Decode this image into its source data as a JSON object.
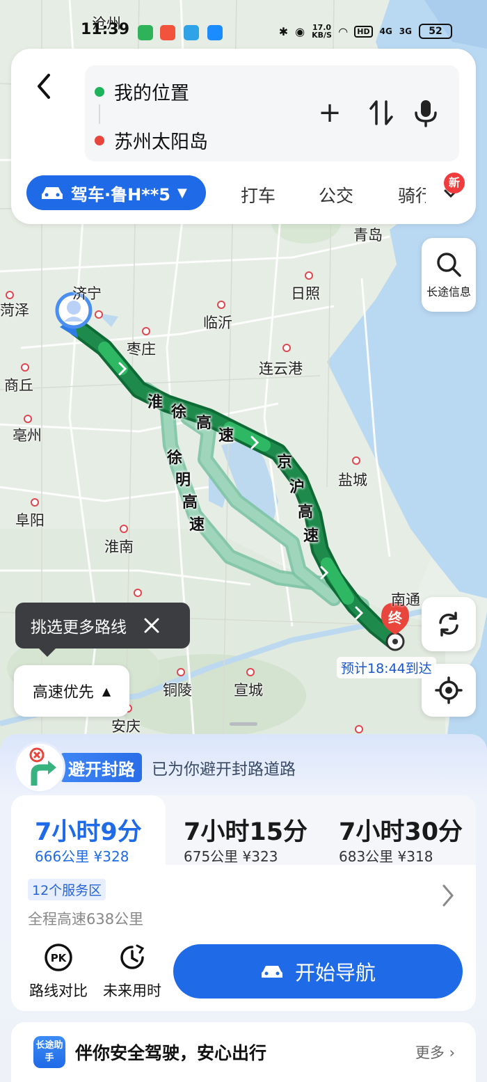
{
  "status_bar": {
    "time": "11:39",
    "net_speed": "17.0",
    "net_unit": "KB/S",
    "hd": "HD",
    "sig1": "4G",
    "sig2": "3G",
    "battery": "52"
  },
  "search": {
    "origin": "我的位置",
    "destination": "苏州太阳岛"
  },
  "modes": {
    "active": "驾车·鲁H**5",
    "tabs": [
      "打车",
      "公交",
      "骑行"
    ],
    "new_badge": "新"
  },
  "map": {
    "cities": [
      "沧州",
      "济宁",
      "菏泽",
      "枣庄",
      "临沂",
      "日照",
      "青岛",
      "连云港",
      "商丘",
      "亳州",
      "盐城",
      "阜阳",
      "淮南",
      "南通",
      "铜陵",
      "宣城",
      "安庆"
    ],
    "roads": [
      "淮",
      "徐",
      "高",
      "速",
      "京",
      "沪",
      "高",
      "速",
      "徐",
      "明",
      "高",
      "速"
    ],
    "end_marker": "终",
    "long_trip_info": "长途信息",
    "eta": "预计18:44到达",
    "more_routes_tip": "挑选更多路线",
    "preference": "高速优先"
  },
  "notice": {
    "tag": "避开封路",
    "text": "已为你避开封路道路"
  },
  "routes": [
    {
      "time": "7小时9分",
      "info": "666公里 ¥328"
    },
    {
      "time": "7小时15分",
      "info": "675公里 ¥323"
    },
    {
      "time": "7小时30分",
      "info": "683公里 ¥318"
    }
  ],
  "route_detail": {
    "service_areas": "12个服务区",
    "highway": "全程高速638公里"
  },
  "actions": {
    "compare": "路线对比",
    "future": "未来用时",
    "start": "开始导航",
    "pk": "PK"
  },
  "assistant": {
    "logo": "长途助手",
    "text": "伴你安全驾驶，安心出行",
    "more": "更多"
  },
  "colors": {
    "primary": "#1f6ae6",
    "route_main": "#1e8a4c",
    "route_alt": "#7dc3a3",
    "end_marker": "#e8453c"
  }
}
